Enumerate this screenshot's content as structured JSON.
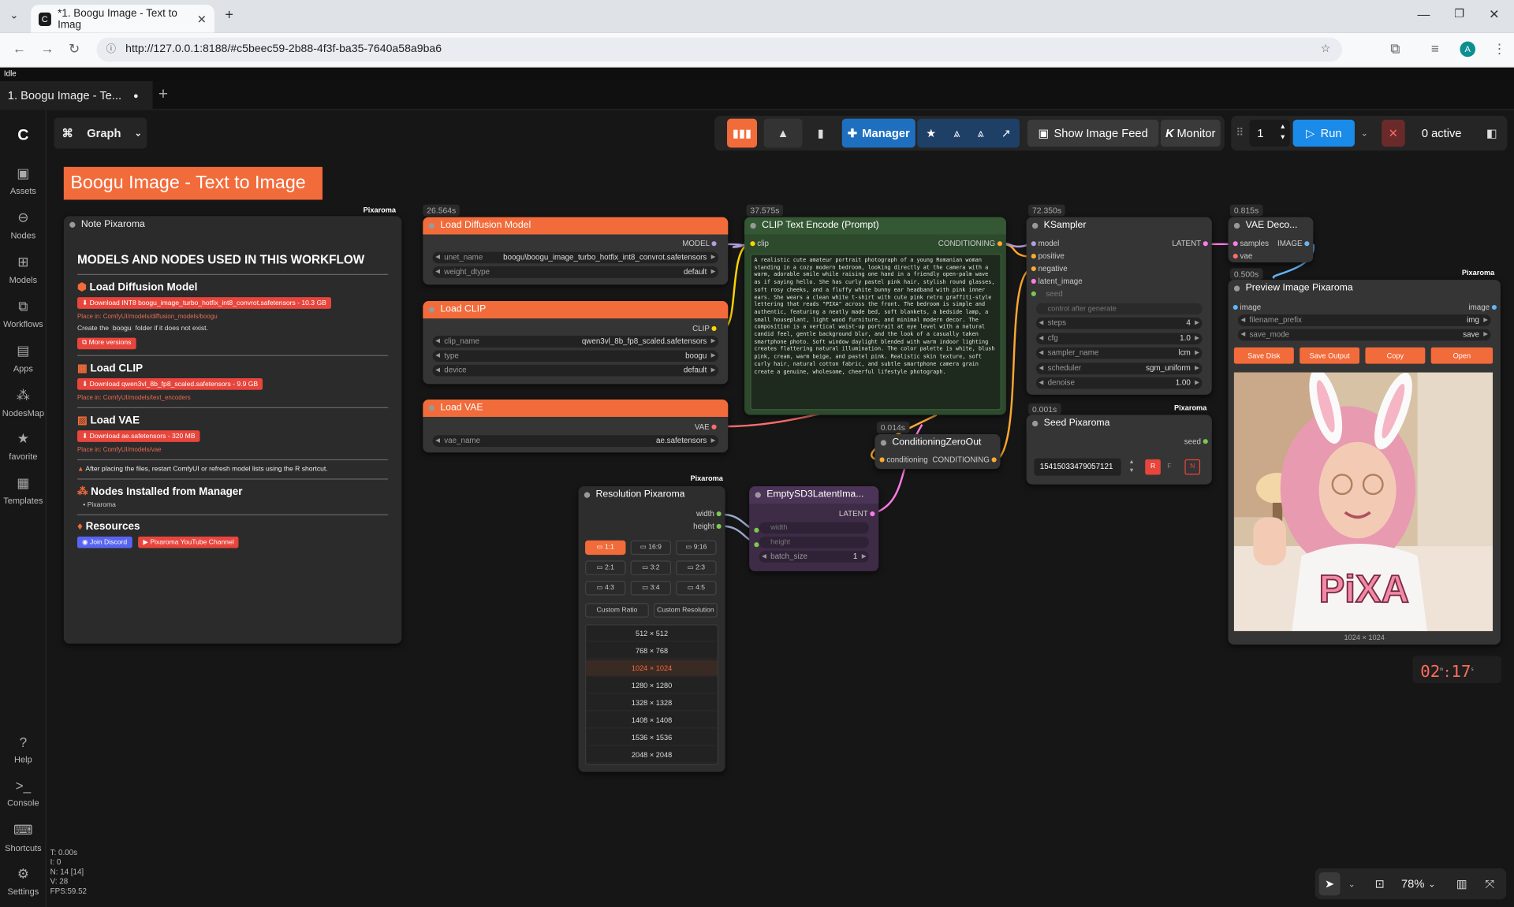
{
  "browser": {
    "tab_title": "*1. Boogu Image - Text to Imag",
    "url": "http://127.0.0.1:8188/#c5beec59-2b88-4f3f-ba35-7640a58a9ba6",
    "avatar": "A"
  },
  "status": "Idle",
  "workflow_tab": "1. Boogu Image - Te...",
  "view_mode": "Graph",
  "sidebar": {
    "items": [
      "Assets",
      "Nodes",
      "Models",
      "Workflows",
      "Apps",
      "NodesMap",
      "favorite",
      "Templates"
    ],
    "bottom": [
      "Help",
      "Console",
      "Shortcuts",
      "Settings"
    ]
  },
  "topbar": {
    "manager": "Manager",
    "feed": "Show Image Feed",
    "monitor": "Monitor",
    "queue_count": "1",
    "run": "Run",
    "active": "0 active"
  },
  "group_title": "Boogu Image - Text to Image",
  "note": {
    "title": "Note Pixaroma",
    "badge": "Pixaroma",
    "heading": "MODELS AND NODES USED IN THIS WORKFLOW",
    "s1": "Load Diffusion Model",
    "s1_dl": "Download INT8 boogu_image_turbo_hotfix_int8_convrot.safetensors  -  10.3 GB",
    "s1_place": "Place in: ComfyUI/models/diffusion_models/boogu",
    "s1_create_a": "Create the",
    "s1_create_b": "boogu",
    "s1_create_c": "folder if it does not exist.",
    "s1_more": "More versions",
    "s2": "Load CLIP",
    "s2_dl": "Download qwen3vl_8b_fp8_scaled.safetensors  -  9.9 GB",
    "s2_place": "Place in: ComfyUI/models/text_encoders",
    "s3": "Load VAE",
    "s3_dl": "Download ae.safetensors  -  320 MB",
    "s3_place": "Place in: ComfyUI/models/vae",
    "warn": "After placing the files, restart ComfyUI or refresh model lists using the R shortcut.",
    "s4": "Nodes Installed from Manager",
    "s4_item": "Pixaroma",
    "s5": "Resources",
    "discord": "Join Discord",
    "youtube": "Pixaroma YouTube Channel"
  },
  "load_model": {
    "time": "26.564s",
    "title": "Load Diffusion Model",
    "out": "MODEL",
    "unet_label": "unet_name",
    "unet_value": "boogu\\boogu_image_turbo_hotfix_int8_convrot.safetensors",
    "dtype_label": "weight_dtype",
    "dtype_value": "default"
  },
  "load_clip": {
    "title": "Load CLIP",
    "out": "CLIP",
    "w1": "clip_name",
    "v1": "qwen3vl_8b_fp8_scaled.safetensors",
    "w2": "type",
    "v2": "boogu",
    "w3": "device",
    "v3": "default"
  },
  "load_vae": {
    "title": "Load VAE",
    "out": "VAE",
    "w1": "vae_name",
    "v1": "ae.safetensors"
  },
  "clip_text": {
    "time": "37.575s",
    "title": "CLIP Text Encode (Prompt)",
    "in": "clip",
    "out": "CONDITIONING",
    "prompt": "A realistic cute amateur portrait photograph of a young Romanian woman standing in a cozy modern bedroom, looking directly at the camera with a warm, adorable smile while raising one hand in a friendly open-palm wave as if saying hello. She has curly pastel pink hair, stylish round glasses, soft rosy cheeks, and a fluffy white bunny ear headband with pink inner ears. She wears a clean white t-shirt with cute pink retro graffiti-style lettering that reads \"PIXA\" across the front. The bedroom is simple and authentic, featuring a neatly made bed, soft blankets, a bedside lamp, a small houseplant, light wood furniture, and minimal modern decor. The composition is a vertical waist-up portrait at eye level with a natural candid feel, gentle background blur, and the look of a casually taken smartphone photo. Soft window daylight blended with warm indoor lighting creates flattering natural illumination. The color palette is white, blush pink, cream, warm beige, and pastel pink. Realistic skin texture, soft curly hair, natural cotton fabric, and subtle smartphone camera grain create a genuine, wholesome, cheerful lifestyle photograph."
  },
  "ksampler": {
    "time": "72.350s",
    "title": "KSampler",
    "inputs": [
      "model",
      "positive",
      "negative",
      "latent_image"
    ],
    "out": "LATENT",
    "seed": "seed",
    "control": "control after generate",
    "widgets": [
      [
        "steps",
        "4"
      ],
      [
        "cfg",
        "1.0"
      ],
      [
        "sampler_name",
        "lcm"
      ],
      [
        "scheduler",
        "sgm_uniform"
      ],
      [
        "denoise",
        "1.00"
      ]
    ]
  },
  "vae_decode": {
    "time": "0.815s",
    "title": "VAE Deco...",
    "in1": "samples",
    "in2": "vae",
    "out": "IMAGE"
  },
  "zero_out": {
    "time": "0.014s",
    "title": "ConditioningZeroOut",
    "in": "conditioning",
    "out": "CONDITIONING"
  },
  "seed": {
    "time": "0.001s",
    "title": "Seed Pixaroma",
    "badge": "Pixaroma",
    "out": "seed",
    "value": "15415033479057121",
    "r": "R",
    "f": "F",
    "n": "N"
  },
  "preview": {
    "time": "0.500s",
    "badge": "Pixaroma",
    "title": "Preview Image Pixaroma",
    "in": "image",
    "out": "image",
    "w1": "filename_prefix",
    "v1": "img",
    "w2": "save_mode",
    "v2": "save",
    "b1": "Save Disk",
    "b2": "Save Output",
    "b3": "Copy",
    "b4": "Open",
    "size": "1024 × 1024",
    "shirt": "PiXA"
  },
  "resolution": {
    "badge": "Pixaroma",
    "title": "Resolution Pixaroma",
    "out1": "width",
    "out2": "height",
    "ratios": [
      "1:1",
      "16:9",
      "9:16",
      "2:1",
      "3:2",
      "2:3",
      "4:3",
      "3:4",
      "4:5"
    ],
    "custom_ratio": "Custom Ratio",
    "custom_res": "Custom Resolution",
    "sizes": [
      "512 × 512",
      "768 × 768",
      "1024 × 1024",
      "1280 × 1280",
      "1328 × 1328",
      "1408 × 1408",
      "1536 × 1536",
      "2048 × 2048"
    ]
  },
  "latent": {
    "title": "EmptySD3LatentIma...",
    "out": "LATENT",
    "w1": "width",
    "w2": "height",
    "w3": "batch_size",
    "v3": "1"
  },
  "timer": {
    "min": "02",
    "sep": ":",
    "sec": "17",
    "m": "m",
    "s": "s"
  },
  "stats": {
    "t": "T: 0.00s",
    "i": "I: 0",
    "n": "N: 14 [14]",
    "v": "V: 28",
    "fps": "FPS:59.52"
  },
  "zoom": "78%",
  "colors": {
    "accent": "#f26b3a",
    "run": "#1a8be8",
    "manager": "#1e6fbf",
    "clip_green": "#2d4a2d",
    "latent_purple": "#3e2c47"
  }
}
